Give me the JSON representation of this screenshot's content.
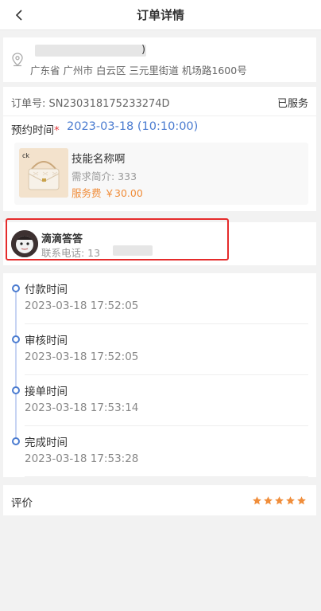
{
  "header": {
    "title": "订单详情"
  },
  "address": {
    "name_tail": ")",
    "full": "广东省 广州市 白云区 三元里街道 机场路1600号"
  },
  "order": {
    "number_label": "订单号: ",
    "number": "SN230318175233274D",
    "status": "已服务",
    "appointment_label": "预约时间",
    "appointment_required": "*",
    "appointment_value": "2023-03-18 (10:10:00)",
    "product": {
      "name": "技能名称啊",
      "desc": "需求简介: 333",
      "price_label": "服务费",
      "price": "￥30.00"
    }
  },
  "user": {
    "name": "滴滴答答",
    "phone_label": "联系电话: 13"
  },
  "timeline": [
    {
      "label": "付款时间",
      "time": "2023-03-18 17:52:05"
    },
    {
      "label": "审核时间",
      "time": "2023-03-18 17:52:05"
    },
    {
      "label": "接单时间",
      "time": "2023-03-18 17:53:14"
    },
    {
      "label": "完成时间",
      "time": "2023-03-18 17:53:28"
    }
  ],
  "review": {
    "label": "评价",
    "rating": 5,
    "max": 5,
    "star_color": "#f08d3a"
  },
  "colors": {
    "accent": "#4a7bd0",
    "price": "#f08d3a",
    "highlight_border": "#e52b2b"
  }
}
